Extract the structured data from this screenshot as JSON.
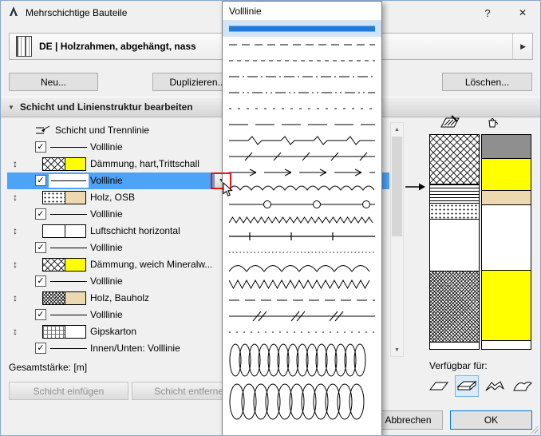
{
  "window": {
    "title": "Mehrschichtige Bauteile",
    "help": "?",
    "close": "✕"
  },
  "composite_selector": {
    "value": "DE | Holzrahmen, abgehängt, nass"
  },
  "actions": {
    "new": "Neu...",
    "duplicate": "Duplizieren...",
    "delete": "Löschen..."
  },
  "section": {
    "title": "Schicht und Linienstruktur bearbeiten"
  },
  "icons": {
    "check": "✓",
    "drag": "↕",
    "dropdown": "▼",
    "collapse": "▼",
    "expand": "▶",
    "scroll_up": "▲",
    "scroll_down": "▼"
  },
  "layer_table": {
    "header_label": "Schicht und Trennlinie",
    "rows": [
      {
        "kind": "separator",
        "checked": true,
        "line": "solid",
        "label": "Volllinie"
      },
      {
        "kind": "layer",
        "cut_fill": "crosshatch",
        "surface_color": "#ffff00",
        "label": "Dämmung, hart,Trittschall"
      },
      {
        "kind": "separator",
        "checked": true,
        "line": "solid",
        "label": "Volllinie",
        "selected": true,
        "has_dropdown": true
      },
      {
        "kind": "layer",
        "cut_fill": "dots",
        "surface_color": "#ecd9b0",
        "label": "Holz, OSB"
      },
      {
        "kind": "separator",
        "checked": true,
        "line": "solid",
        "label": "Volllinie"
      },
      {
        "kind": "layer",
        "cut_fill": "blank",
        "surface_color": "#ffffff",
        "label": "Luftschicht horizontal"
      },
      {
        "kind": "separator",
        "checked": true,
        "line": "solid",
        "label": "Volllinie"
      },
      {
        "kind": "layer",
        "cut_fill": "crosshatch",
        "surface_color": "#ffff00",
        "label": "Dämmung, weich Mineralw..."
      },
      {
        "kind": "separator",
        "checked": true,
        "line": "solid",
        "label": "Volllinie"
      },
      {
        "kind": "layer",
        "cut_fill": "crosshatch-dense",
        "surface_color": "#ecd9b0",
        "label": "Holz, Bauholz"
      },
      {
        "kind": "separator",
        "checked": true,
        "line": "solid",
        "label": "Volllinie"
      },
      {
        "kind": "layer",
        "cut_fill": "grid",
        "surface_color": "#ffffff",
        "label": "Gipskarton"
      },
      {
        "kind": "separator",
        "checked": true,
        "line": "solid",
        "label": "Innen/Unten: Volllinie"
      }
    ],
    "total_label": "Gesamtstärke: [m]"
  },
  "layer_actions": {
    "insert": "Schicht einfügen",
    "remove": "Schicht entfernen"
  },
  "preview": {
    "cut_bands": [
      {
        "pattern": "crosshatch",
        "height": 62
      },
      {
        "pattern": "hlines",
        "height": 24
      },
      {
        "pattern": "dots",
        "height": 20
      },
      {
        "pattern": "blank",
        "height": 65
      },
      {
        "pattern": "crosshatch-dense",
        "height": 89
      },
      {
        "pattern": "blank",
        "height": 8
      }
    ],
    "surface_bands": [
      {
        "color": "#8f8f8f",
        "height": 30
      },
      {
        "color": "#ffff00",
        "height": 40
      },
      {
        "color": "#ecd9b0",
        "height": 18
      },
      {
        "color": "#ffffff",
        "height": 82
      },
      {
        "color": "#ffff00",
        "height": 88
      },
      {
        "color": "#ffffff",
        "height": 10
      }
    ]
  },
  "availability": {
    "label": "Verfügbar für:",
    "options": [
      {
        "name": "wall",
        "selected": false
      },
      {
        "name": "slab",
        "selected": true
      },
      {
        "name": "roof",
        "selected": false
      },
      {
        "name": "shell",
        "selected": false
      }
    ]
  },
  "popup": {
    "title": "Volllinie",
    "selected_color": "#1f7bd9",
    "items": [
      {
        "pattern": "solid",
        "selected": true
      },
      {
        "pattern": "dash-long"
      },
      {
        "pattern": "dash-short"
      },
      {
        "pattern": "dash-dot"
      },
      {
        "pattern": "dash-dot-dot"
      },
      {
        "pattern": "dash-sparse"
      },
      {
        "pattern": "dash-xlong"
      },
      {
        "pattern": "spike-zigzag"
      },
      {
        "pattern": "slash-ticks"
      },
      {
        "pattern": "arrows"
      },
      {
        "pattern": "wave-small"
      },
      {
        "pattern": "circles"
      },
      {
        "pattern": "sawtooth-small"
      },
      {
        "pattern": "plus-ticks"
      },
      {
        "pattern": "dot-dense"
      },
      {
        "pattern": "scallop-large"
      },
      {
        "pattern": "triangle-dense"
      },
      {
        "pattern": "dash-plain"
      },
      {
        "pattern": "dash-slash"
      },
      {
        "pattern": "dot-sparse"
      },
      {
        "pattern": "loops-small",
        "tall": true
      },
      {
        "pattern": "loops-large",
        "tall": true
      }
    ]
  },
  "footer": {
    "cancel": "Abbrechen",
    "ok": "OK"
  }
}
